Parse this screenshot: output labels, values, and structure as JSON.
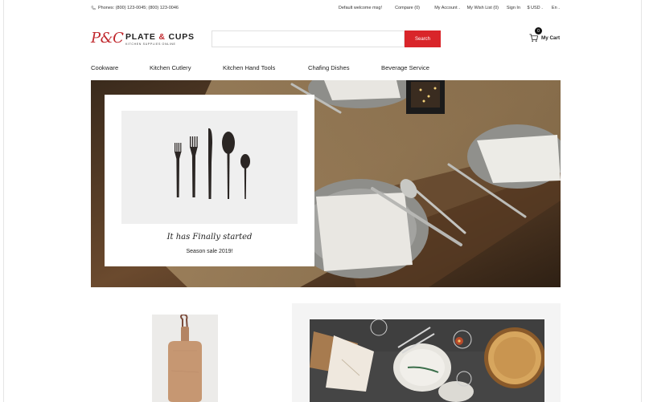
{
  "topbar": {
    "phones": "Phones: (800) 123-0045; (800) 123-0046",
    "welcome": "Default welcome msg!",
    "compare": "Compare (0)",
    "account": "My Account",
    "wishlist": "My Wish List (0)",
    "signin": "Sign In",
    "currency": "$ USD",
    "language": "En"
  },
  "brand": {
    "monogram": "P&C",
    "name_left": "PLATE",
    "name_amp": "&",
    "name_right": "CUPS",
    "tagline": "KITCHEN SUPPLIES ONLINE",
    "accent": "#c0282d"
  },
  "search": {
    "placeholder": "",
    "button": "Search",
    "button_color": "#d9252a"
  },
  "cart": {
    "count": "0",
    "label": "My Cart"
  },
  "nav": {
    "items": [
      "Cookware",
      "Kitchen Cutlery",
      "Kitchen Hand Tools",
      "Chafing Dishes",
      "Beverage Service"
    ]
  },
  "hero": {
    "title": "It has Finally started",
    "subtitle": "Season sale 2019!"
  },
  "icons": {
    "phone": "phone-icon",
    "cart": "cart-icon",
    "chevron": "chevron-down-icon"
  }
}
